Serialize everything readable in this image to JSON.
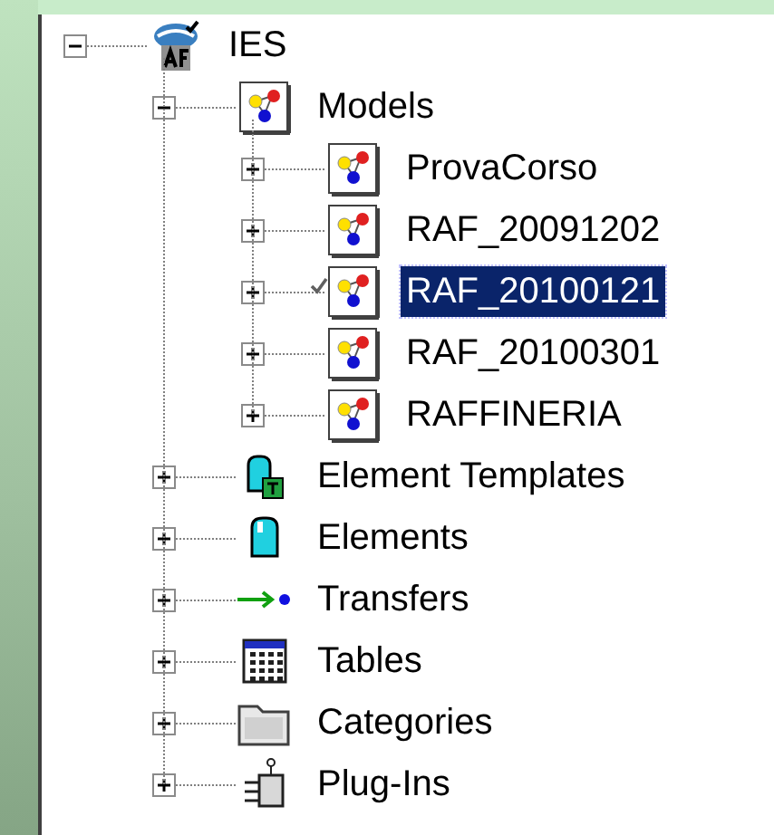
{
  "tree": [
    {
      "label": "IES",
      "kind": "server",
      "expanded": true,
      "selected": false,
      "children": [
        {
          "label": "Models",
          "kind": "models",
          "expanded": true,
          "selected": false,
          "children": [
            {
              "label": "ProvaCorso",
              "kind": "model",
              "expanded": false,
              "selected": false,
              "checked": false
            },
            {
              "label": "RAF_20091202",
              "kind": "model",
              "expanded": false,
              "selected": false,
              "checked": false
            },
            {
              "label": "RAF_20100121",
              "kind": "model",
              "expanded": false,
              "selected": true,
              "checked": true
            },
            {
              "label": "RAF_20100301",
              "kind": "model",
              "expanded": false,
              "selected": false,
              "checked": false
            },
            {
              "label": "RAFFINERIA",
              "kind": "model",
              "expanded": false,
              "selected": false,
              "checked": false
            }
          ]
        },
        {
          "label": "Element Templates",
          "kind": "element-template",
          "expanded": false,
          "selected": false
        },
        {
          "label": "Elements",
          "kind": "element",
          "expanded": false,
          "selected": false
        },
        {
          "label": "Transfers",
          "kind": "transfer",
          "expanded": false,
          "selected": false
        },
        {
          "label": "Tables",
          "kind": "table",
          "expanded": false,
          "selected": false
        },
        {
          "label": "Categories",
          "kind": "category",
          "expanded": false,
          "selected": false
        },
        {
          "label": "Plug-Ins",
          "kind": "plugin",
          "expanded": false,
          "selected": false
        }
      ]
    }
  ]
}
